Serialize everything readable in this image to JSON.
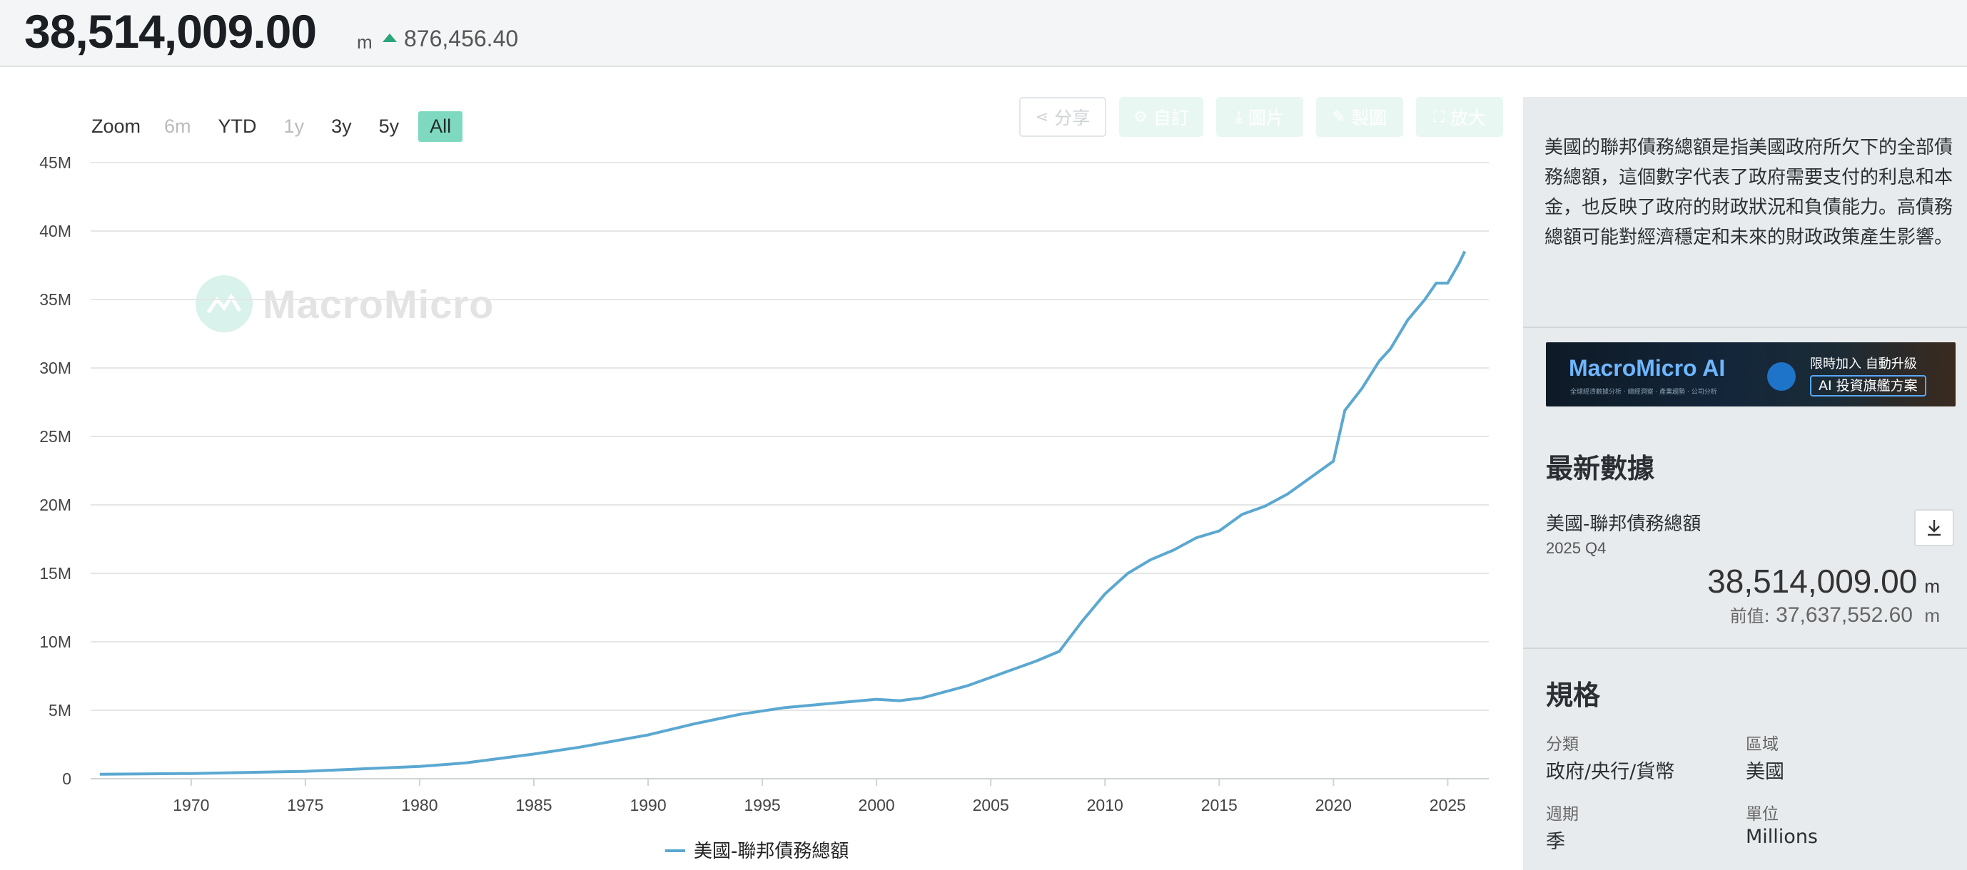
{
  "header": {
    "value": "38,514,009.00",
    "unit": "m",
    "change": "876,456.40",
    "change_direction": "up",
    "change_color": "#2aa67a"
  },
  "toolbar": {
    "zoom_label": "Zoom",
    "zoom_options": [
      "6m",
      "YTD",
      "1y",
      "3y",
      "5y",
      "All"
    ],
    "zoom_selected": "All",
    "zoom_disabled": [
      "6m",
      "1y"
    ],
    "accent_color": "#7fd9c1",
    "buttons": [
      {
        "label": "分享",
        "icon": "share-icon"
      },
      {
        "label": "自訂",
        "icon": "gear-icon"
      },
      {
        "label": "圖片",
        "icon": "download-icon"
      },
      {
        "label": "製圖",
        "icon": "pencil-icon"
      },
      {
        "label": "放大",
        "icon": "expand-icon"
      }
    ]
  },
  "watermark": "MacroMicro",
  "chart_data": {
    "type": "line",
    "title": "",
    "xlabel": "",
    "ylabel": "",
    "x_ticks": [
      "1970",
      "1975",
      "1980",
      "1985",
      "1990",
      "1995",
      "2000",
      "2005",
      "2010",
      "2015",
      "2020",
      "2025"
    ],
    "y_ticks": [
      "0",
      "5M",
      "10M",
      "15M",
      "20M",
      "25M",
      "30M",
      "35M",
      "40M",
      "45M"
    ],
    "xlim": [
      1965.6,
      2026.8
    ],
    "ylim": [
      0,
      45000000
    ],
    "grid": true,
    "legend_position": "bottom-center",
    "series": [
      {
        "name": "美國-聯邦債務總額",
        "color": "#5ba8d1",
        "x": [
          "1966-01-01",
          "1970-01-01",
          "1975-01-01",
          "1980-01-01",
          "1982-01-01",
          "1985-01-01",
          "1987-01-01",
          "1990-01-01",
          "1992-01-01",
          "1994-01-01",
          "1996-01-01",
          "1998-01-01",
          "2000-01-01",
          "2001-01-01",
          "2002-01-01",
          "2004-01-01",
          "2006-01-01",
          "2007-01-01",
          "2008-01-01",
          "2009-01-01",
          "2010-01-01",
          "2011-01-01",
          "2012-01-01",
          "2013-01-01",
          "2014-01-01",
          "2015-01-01",
          "2016-01-01",
          "2017-01-01",
          "2018-01-01",
          "2019-01-01",
          "2020-01-01",
          "2020-07-01",
          "2021-04-01",
          "2022-01-01",
          "2022-07-01",
          "2023-04-01",
          "2024-01-01",
          "2024-07-01",
          "2025-01-01",
          "2025-07-01",
          "2025-10-01"
        ],
        "values": [
          330000,
          380000,
          540000,
          900000,
          1150000,
          1800000,
          2300000,
          3200000,
          4000000,
          4700000,
          5200000,
          5500000,
          5800000,
          5700000,
          5900000,
          6800000,
          8000000,
          8600000,
          9300000,
          11500000,
          13500000,
          15000000,
          16000000,
          16700000,
          17600000,
          18100000,
          19300000,
          19900000,
          20800000,
          22000000,
          23200000,
          26900000,
          28500000,
          30500000,
          31400000,
          33500000,
          35000000,
          36200000,
          36200000,
          37637552.6,
          38514009
        ]
      }
    ]
  },
  "side": {
    "description": "美國的聯邦債務總額是指美國政府所欠下的全部債務總額，這個數字代表了政府需要支付的利息和本金，也反映了政府的財政狀況和負債能力。高債務總額可能對經濟穩定和未來的財政政策產生影響。",
    "banner": {
      "title": "MacroMicro AI",
      "sub": "全球經濟數據分析 · 總經洞察 · 產業趨勢 · 公司分析",
      "right_line1": "限時加入 自動升級",
      "right_line2": "AI 投資旗艦方案"
    },
    "latest": {
      "title": "最新數據",
      "series_name": "美國-聯邦債務總額",
      "period": "2025 Q4",
      "value": "38,514,009.00",
      "unit": "m",
      "prev_label": "前值:",
      "prev_value": "37,637,552.60",
      "prev_unit": "m"
    },
    "specs": {
      "title": "規格",
      "category_label": "分類",
      "category_value": "政府/央行/貨幣",
      "region_label": "區域",
      "region_value": "美國",
      "frequency_label": "週期",
      "frequency_value": "季",
      "unit_label": "單位",
      "unit_value": "Millions"
    }
  }
}
